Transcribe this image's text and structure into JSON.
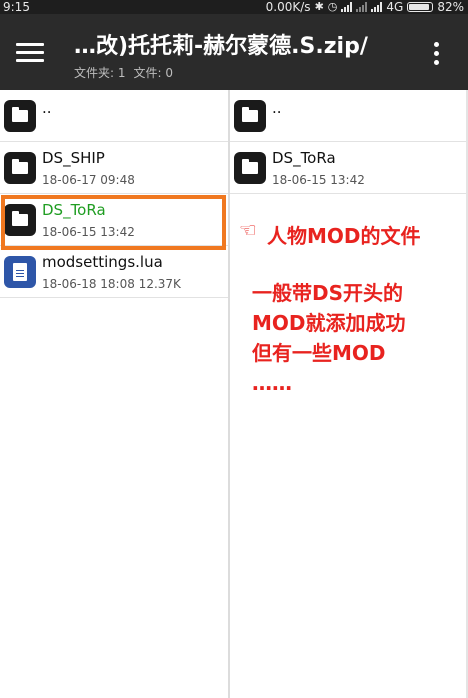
{
  "statusbar": {
    "time": "9:15",
    "net_speed": "0.00K/s",
    "network": "4G",
    "battery": "82%",
    "battery_level": 0.82
  },
  "appbar": {
    "title": "…改)托托莉-赫尔蒙德.S.zip/",
    "folder_count": "文件夹: 1",
    "file_count": "文件: 0"
  },
  "left_pane": {
    "items": [
      {
        "name": "..",
        "meta": "",
        "type": "folder"
      },
      {
        "name": "DS_SHIP",
        "meta": "18-06-17 09:48",
        "type": "folder"
      },
      {
        "name": "DS_ToRa",
        "meta": "18-06-15 13:42",
        "type": "folder",
        "selected": true
      },
      {
        "name": "modsettings.lua",
        "meta": "18-06-18 18:08  12.37K",
        "type": "file"
      }
    ]
  },
  "right_pane": {
    "items": [
      {
        "name": "..",
        "meta": "",
        "type": "folder"
      },
      {
        "name": "DS_ToRa",
        "meta": "18-06-15 13:42",
        "type": "folder"
      }
    ]
  },
  "annotation": {
    "pointer": "☜",
    "label": "人物MOD的文件",
    "line1": "一般带DS开头的",
    "line2": "MOD就添加成功",
    "line3": "但有一些MOD",
    "line4": "……",
    "color": "#e8231f"
  },
  "colors": {
    "appbar": "#2b2b2b",
    "highlight": "#f07820",
    "selected_text": "#1f9d22",
    "file_icon": "#2e56a8"
  }
}
